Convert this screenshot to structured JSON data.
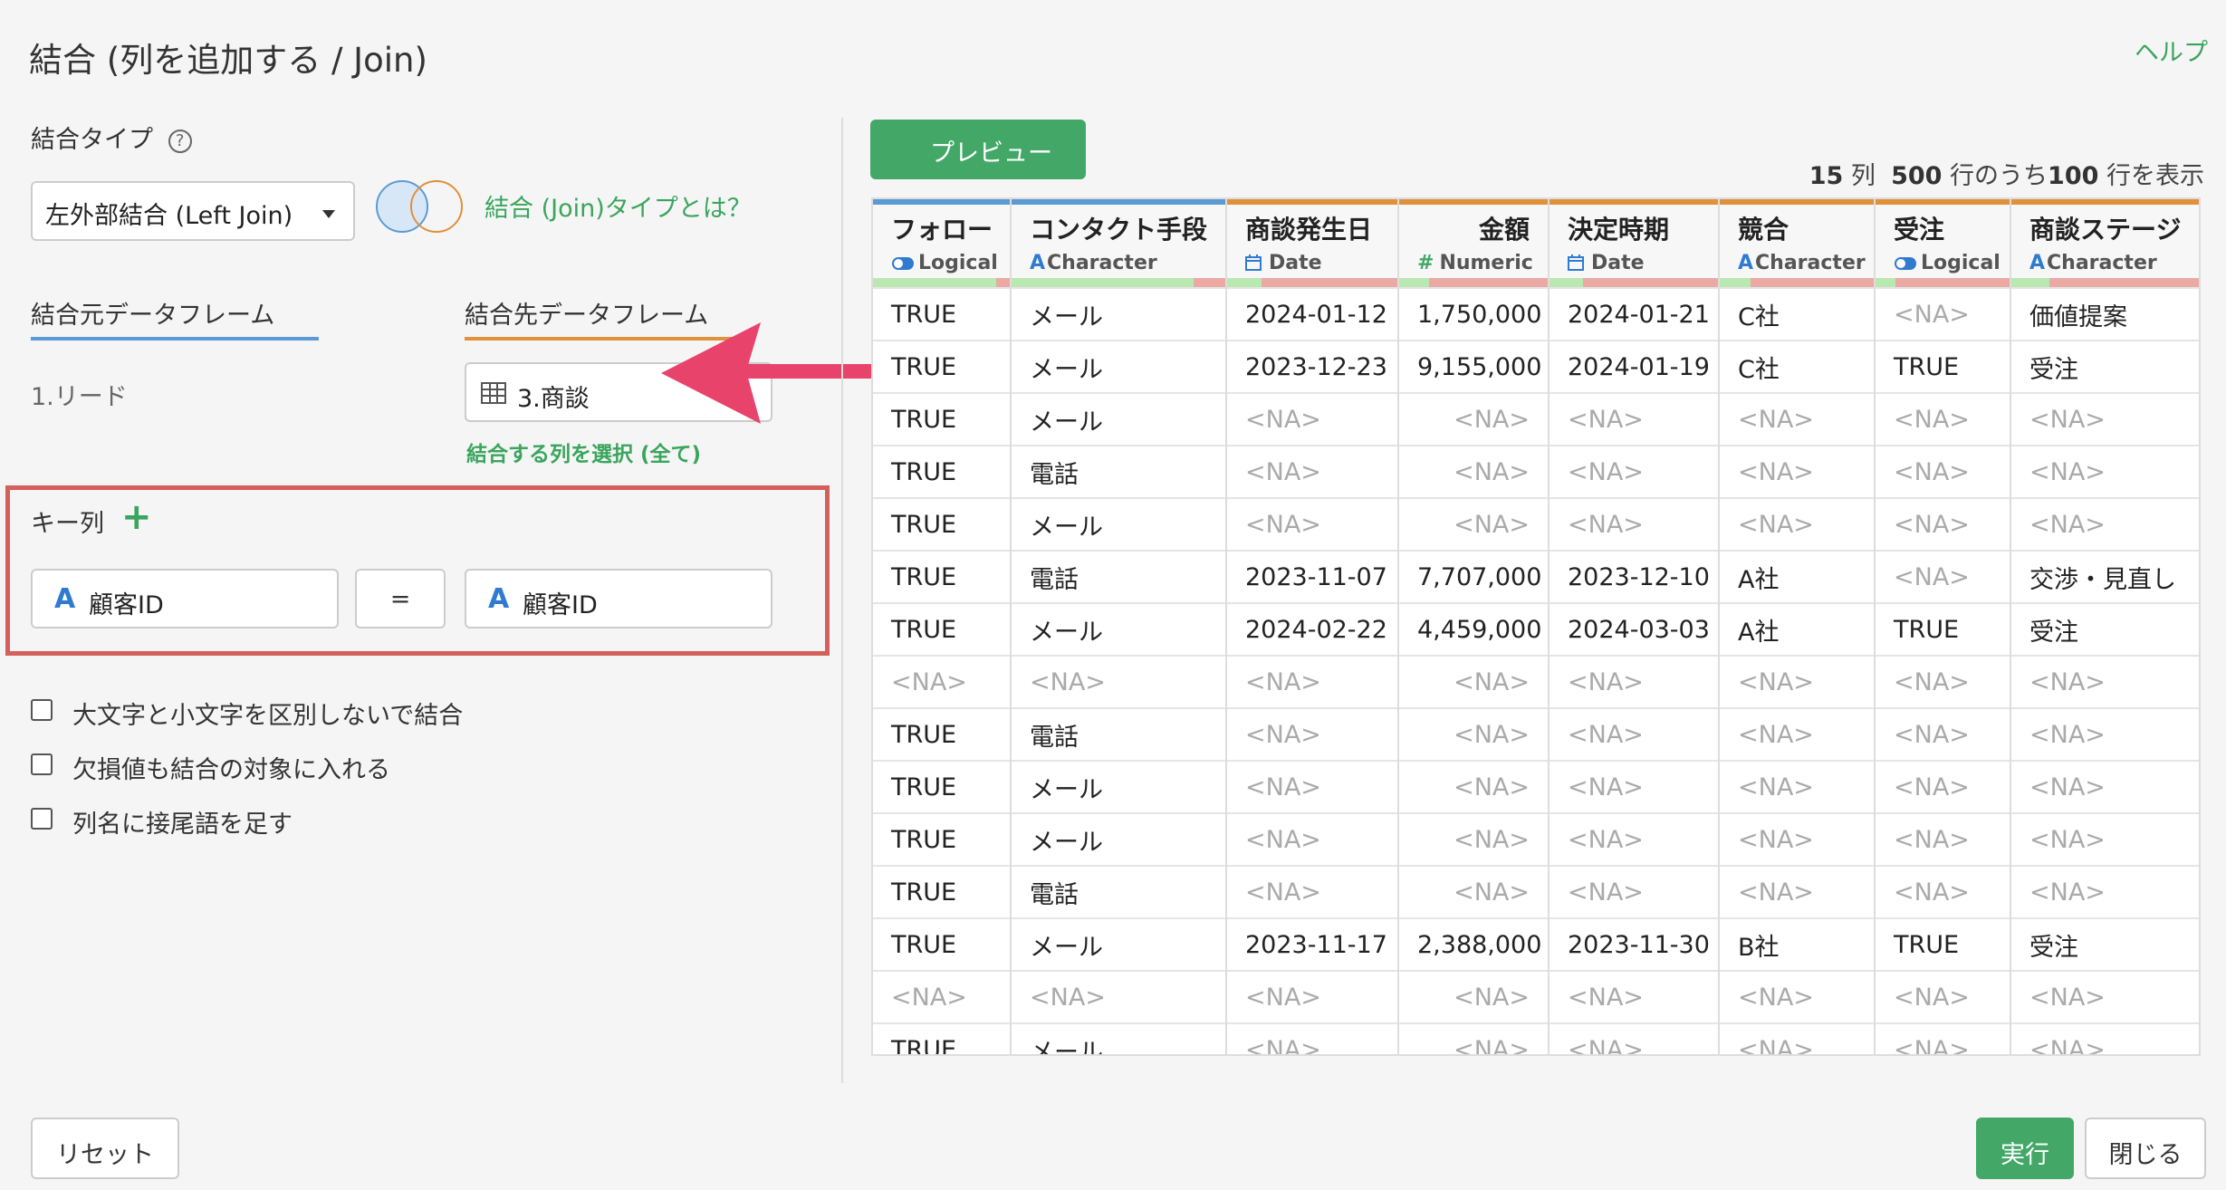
{
  "header": {
    "title": "結合 (列を追加する / Join)",
    "help": "ヘルプ"
  },
  "join_type": {
    "label": "結合タイプ",
    "help_icon": "?",
    "selected": "左外部結合 (Left Join)",
    "link": "結合 (Join)タイプとは？"
  },
  "source": {
    "tab_label": "結合元データフレーム",
    "value": "1.リード",
    "color": "#5b9bd5"
  },
  "target": {
    "tab_label": "結合先データフレーム",
    "value": "3.商談",
    "select_cols": "結合する列を選択 (全て)",
    "color": "#e0913a"
  },
  "keys": {
    "label": "キー列",
    "add": "+",
    "left": "顧客ID",
    "eq": "=",
    "right": "顧客ID",
    "type_icon": "A"
  },
  "options": [
    {
      "label": "大文字と小文字を区別しないで結合"
    },
    {
      "label": "欠損値も結合の対象に入れる"
    },
    {
      "label": "列名に接尾語を足す"
    }
  ],
  "preview": {
    "button": "プレビュー"
  },
  "row_info": {
    "cols": "15",
    "cols_unit": "列",
    "total": "500",
    "mid": "行のうち",
    "shown": "100",
    "tail": "行を表示"
  },
  "table": {
    "columns": [
      {
        "name": "フォロー",
        "type": "Logical",
        "icon": "toggle-icon",
        "bar": "#5b9bd5",
        "q": [
          0.9,
          0.1
        ]
      },
      {
        "name": "コンタクト手段",
        "type": "Character",
        "icon": "A",
        "bar": "#5b9bd5",
        "q": [
          0.85,
          0.15
        ]
      },
      {
        "name": "商談発生日",
        "type": "Date",
        "icon": "calendar-icon",
        "bar": "#e0913a",
        "q": [
          0.2,
          0.8
        ]
      },
      {
        "name": "金額",
        "type": "Numeric",
        "icon": "#",
        "bar": "#e0913a",
        "q": [
          0.2,
          0.8
        ]
      },
      {
        "name": "決定時期",
        "type": "Date",
        "icon": "calendar-icon",
        "bar": "#e0913a",
        "q": [
          0.2,
          0.8
        ]
      },
      {
        "name": "競合",
        "type": "Character",
        "icon": "A",
        "bar": "#e0913a",
        "q": [
          0.2,
          0.8
        ]
      },
      {
        "name": "受注",
        "type": "Logical",
        "icon": "toggle-icon",
        "bar": "#e0913a",
        "q": [
          0.15,
          0.85
        ]
      },
      {
        "name": "商談ステージ",
        "type": "Character",
        "icon": "A",
        "bar": "#e0913a",
        "q": [
          0.2,
          0.8
        ]
      }
    ],
    "rows": [
      [
        "TRUE",
        "メール",
        "2024-01-12",
        "1,750,000",
        "2024-01-21",
        "C社",
        "<NA>",
        "価値提案"
      ],
      [
        "TRUE",
        "メール",
        "2023-12-23",
        "9,155,000",
        "2024-01-19",
        "C社",
        "TRUE",
        "受注"
      ],
      [
        "TRUE",
        "メール",
        "<NA>",
        "<NA>",
        "<NA>",
        "<NA>",
        "<NA>",
        "<NA>"
      ],
      [
        "TRUE",
        "電話",
        "<NA>",
        "<NA>",
        "<NA>",
        "<NA>",
        "<NA>",
        "<NA>"
      ],
      [
        "TRUE",
        "メール",
        "<NA>",
        "<NA>",
        "<NA>",
        "<NA>",
        "<NA>",
        "<NA>"
      ],
      [
        "TRUE",
        "電話",
        "2023-11-07",
        "7,707,000",
        "2023-12-10",
        "A社",
        "<NA>",
        "交渉・見直し"
      ],
      [
        "TRUE",
        "メール",
        "2024-02-22",
        "4,459,000",
        "2024-03-03",
        "A社",
        "TRUE",
        "受注"
      ],
      [
        "<NA>",
        "<NA>",
        "<NA>",
        "<NA>",
        "<NA>",
        "<NA>",
        "<NA>",
        "<NA>"
      ],
      [
        "TRUE",
        "電話",
        "<NA>",
        "<NA>",
        "<NA>",
        "<NA>",
        "<NA>",
        "<NA>"
      ],
      [
        "TRUE",
        "メール",
        "<NA>",
        "<NA>",
        "<NA>",
        "<NA>",
        "<NA>",
        "<NA>"
      ],
      [
        "TRUE",
        "メール",
        "<NA>",
        "<NA>",
        "<NA>",
        "<NA>",
        "<NA>",
        "<NA>"
      ],
      [
        "TRUE",
        "電話",
        "<NA>",
        "<NA>",
        "<NA>",
        "<NA>",
        "<NA>",
        "<NA>"
      ],
      [
        "TRUE",
        "メール",
        "2023-11-17",
        "2,388,000",
        "2023-11-30",
        "B社",
        "TRUE",
        "受注"
      ],
      [
        "<NA>",
        "<NA>",
        "<NA>",
        "<NA>",
        "<NA>",
        "<NA>",
        "<NA>",
        "<NA>"
      ],
      [
        "TRUE",
        "メール",
        "<NA>",
        "<NA>",
        "<NA>",
        "<NA>",
        "<NA>",
        "<NA>"
      ]
    ]
  },
  "footer": {
    "reset": "リセット",
    "run": "実行",
    "close": "閉じる"
  },
  "colors": {
    "accent": "#43a867",
    "highlight": "#d4605c",
    "arrow": "#e8436b",
    "source": "#5b9bd5",
    "target": "#e0913a"
  }
}
